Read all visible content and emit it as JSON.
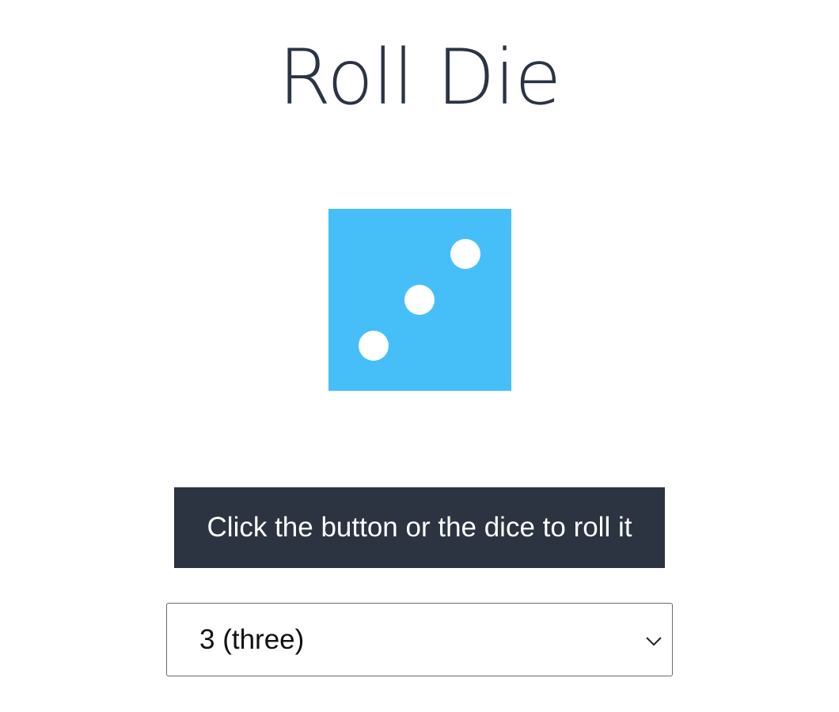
{
  "page": {
    "title": "Roll Die"
  },
  "die": {
    "face_value": 3,
    "color": "#46bff9",
    "pip_color": "#ffffff",
    "icon": "die-face-3-icon"
  },
  "roll_button": {
    "label": "Click the button or the dice to roll it",
    "background": "#2b3440",
    "text_color": "#ffffff"
  },
  "face_select": {
    "selected": "3 (three)",
    "icon": "chevron-down-icon"
  }
}
